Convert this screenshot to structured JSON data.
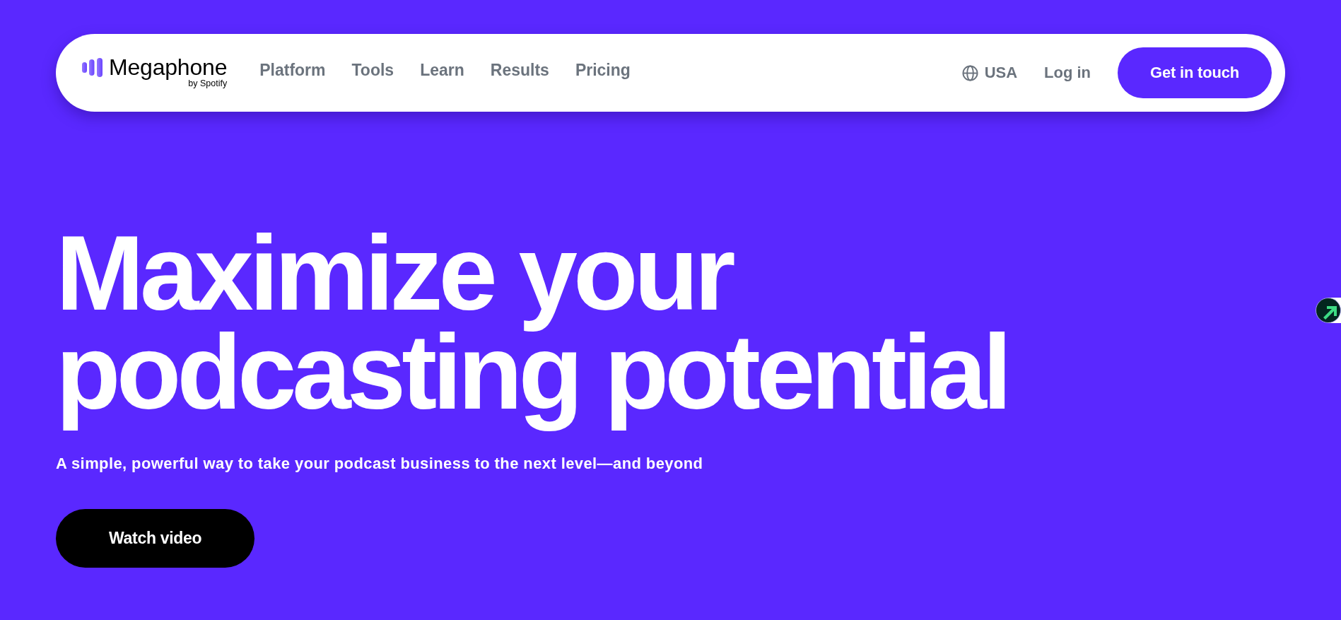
{
  "nav": {
    "logo": {
      "name": "Megaphone",
      "tagline": "by Spotify"
    },
    "links": [
      "Platform",
      "Tools",
      "Learn",
      "Results",
      "Pricing"
    ],
    "region": "USA",
    "login": "Log in",
    "cta": "Get in touch"
  },
  "hero": {
    "headline_lines": [
      "Maximize your",
      "podcasting potential"
    ],
    "subtitle": "A simple, powerful way to take your podcast business to the next level—and beyond",
    "button": "Watch video"
  }
}
